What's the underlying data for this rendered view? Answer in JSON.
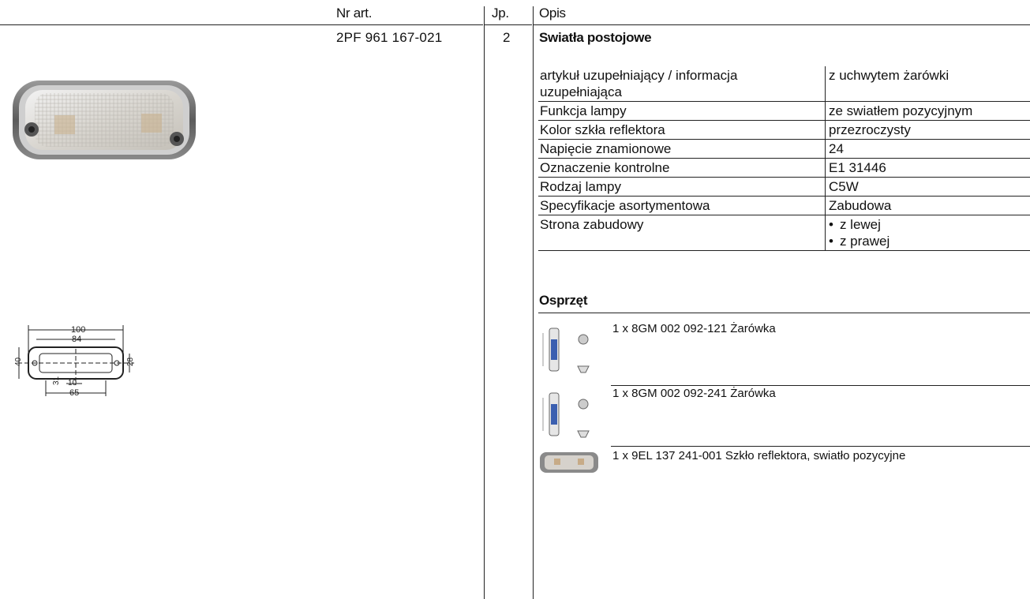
{
  "header": {
    "col_article": "Nr art.",
    "col_qty": "Jp.",
    "col_desc": "Opis"
  },
  "product": {
    "article_number": "2PF 961 167-021",
    "quantity": "2",
    "title": "Swiatła postojowe",
    "specs": [
      {
        "key": "artykuł uzupełniający / informacja uzupełniająca",
        "value": "z uchwytem żarówki"
      },
      {
        "key": "Funkcja lampy",
        "value": "ze swiatłem pozycyjnym"
      },
      {
        "key": "Kolor szkła reflektora",
        "value": "przezroczysty"
      },
      {
        "key": "Napięcie znamionowe",
        "value": "24"
      },
      {
        "key": "Oznaczenie kontrolne",
        "value": "E1 31446"
      },
      {
        "key": "Rodzaj lampy",
        "value": "C5W"
      },
      {
        "key": "Specyfikacje asortymentowa",
        "value": "Zabudowa"
      },
      {
        "key": "Strona zabudowy",
        "values": [
          "z lewej",
          "z prawej"
        ]
      }
    ]
  },
  "drawing": {
    "dims": [
      "100",
      "84",
      "40",
      "28",
      "31",
      "10",
      "65"
    ]
  },
  "accessories": {
    "title": "Osprzęt",
    "items": [
      {
        "text": "1 x 8GM 002 092-121 Żarówka"
      },
      {
        "text": "1 x 8GM 002 092-241 Żarówka"
      },
      {
        "text": "1 x 9EL 137 241-001 Szkło reflektora, swiatło pozycyjne"
      }
    ]
  }
}
